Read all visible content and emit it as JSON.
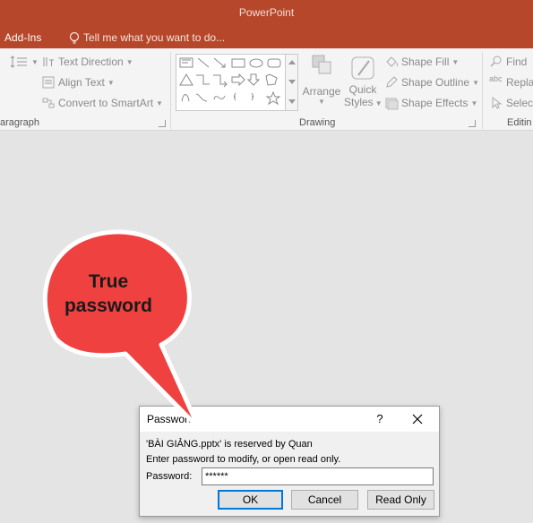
{
  "titlebar": {
    "title": "PowerPoint"
  },
  "menubar": {
    "tab_addins": "Add-Ins",
    "tell_me": "Tell me what you want to do..."
  },
  "ribbon": {
    "paragraph": {
      "text_direction": "Text Direction",
      "align_text": "Align Text",
      "convert_smartart": "Convert to SmartArt",
      "label": "aragraph"
    },
    "drawing": {
      "arrange": "Arrange",
      "quick_styles_line1": "Quick",
      "quick_styles_line2": "Styles",
      "shape_fill": "Shape Fill",
      "shape_outline": "Shape Outline",
      "shape_effects": "Shape Effects",
      "label": "Drawing"
    },
    "editing": {
      "find": "Find",
      "replace": "Repla",
      "select": "Selec",
      "label": "Editin",
      "abc_icon_text": "abc"
    }
  },
  "callout": {
    "line1": "True",
    "line2": "password",
    "fill": "#f04141"
  },
  "dialog": {
    "title": "Password",
    "help": "?",
    "message1": "'BÀI GIẢNG.pptx' is reserved by Quan",
    "message2": "Enter password to modify, or open read only.",
    "password_label": "Password:",
    "password_value": "******",
    "ok": "OK",
    "cancel": "Cancel",
    "read_only": "Read Only"
  },
  "colors": {
    "accent": "#b7472a",
    "focus": "#0078d7"
  }
}
